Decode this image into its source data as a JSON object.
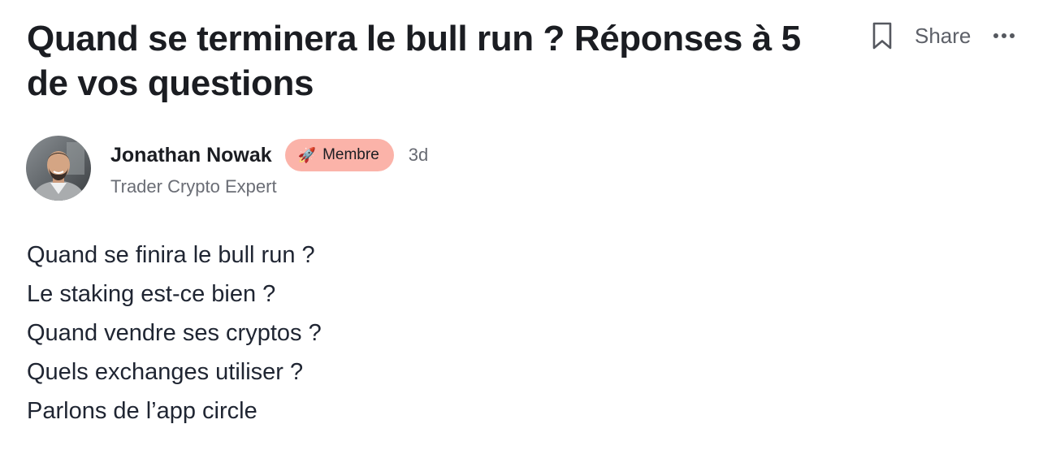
{
  "post": {
    "title": "Quand se terminera le bull run ? Réponses à 5 de vos questions",
    "actions": {
      "share_label": "Share"
    },
    "author": {
      "name": "Jonathan Nowak",
      "badge_label": "Membre",
      "badge_icon": "rocket",
      "badge_color": "#fbb3a9",
      "time": "3d",
      "role": "Trader Crypto Expert"
    },
    "body_lines": [
      "Quand se finira le bull run ?",
      "Le staking est-ce bien ?",
      "Quand vendre ses cryptos ?",
      "Quels exchanges utiliser ?",
      "Parlons de l’app circle"
    ]
  }
}
